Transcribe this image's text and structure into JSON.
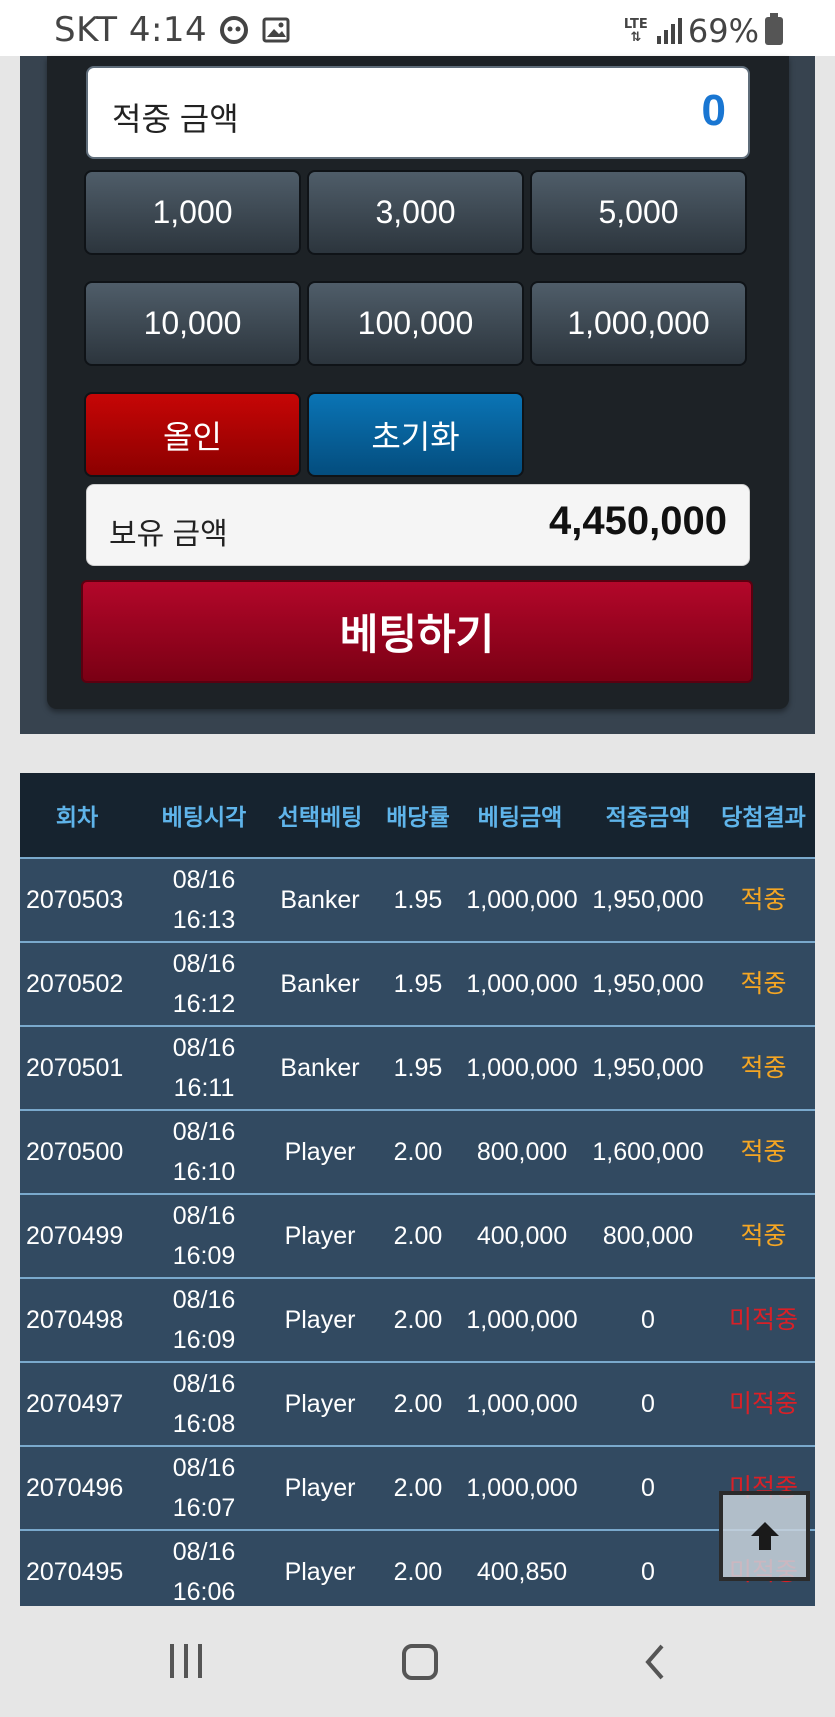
{
  "status_bar": {
    "carrier_time": "SKT 4:14",
    "lte": "LTE",
    "battery_pct": "69%",
    "icons": [
      "face-icon",
      "gallery-icon",
      "signal-icon",
      "battery-icon"
    ]
  },
  "panel": {
    "hit_amount_label": "적중 금액",
    "hit_amount_value": "0",
    "chips": [
      "1,000",
      "3,000",
      "5,000",
      "10,000",
      "100,000",
      "1,000,000"
    ],
    "allin_label": "올인",
    "reset_label": "초기화",
    "holding_label": "보유 금액",
    "holding_value": "4,450,000",
    "bet_button_label": "베팅하기"
  },
  "history": {
    "headers": [
      "회차",
      "베팅시각",
      "선택베팅",
      "배당률",
      "베팅금액",
      "적중금액",
      "당첨결과"
    ],
    "rows": [
      {
        "round": "2070503",
        "date": "08/16",
        "time": "16:13",
        "pick": "Banker",
        "odds": "1.95",
        "bet": "1,000,000",
        "win": "1,950,000",
        "result": "적중",
        "status": "hit"
      },
      {
        "round": "2070502",
        "date": "08/16",
        "time": "16:12",
        "pick": "Banker",
        "odds": "1.95",
        "bet": "1,000,000",
        "win": "1,950,000",
        "result": "적중",
        "status": "hit"
      },
      {
        "round": "2070501",
        "date": "08/16",
        "time": "16:11",
        "pick": "Banker",
        "odds": "1.95",
        "bet": "1,000,000",
        "win": "1,950,000",
        "result": "적중",
        "status": "hit"
      },
      {
        "round": "2070500",
        "date": "08/16",
        "time": "16:10",
        "pick": "Player",
        "odds": "2.00",
        "bet": "800,000",
        "win": "1,600,000",
        "result": "적중",
        "status": "hit"
      },
      {
        "round": "2070499",
        "date": "08/16",
        "time": "16:09",
        "pick": "Player",
        "odds": "2.00",
        "bet": "400,000",
        "win": "800,000",
        "result": "적중",
        "status": "hit"
      },
      {
        "round": "2070498",
        "date": "08/16",
        "time": "16:09",
        "pick": "Player",
        "odds": "2.00",
        "bet": "1,000,000",
        "win": "0",
        "result": "미적중",
        "status": "miss"
      },
      {
        "round": "2070497",
        "date": "08/16",
        "time": "16:08",
        "pick": "Player",
        "odds": "2.00",
        "bet": "1,000,000",
        "win": "0",
        "result": "미적중",
        "status": "miss"
      },
      {
        "round": "2070496",
        "date": "08/16",
        "time": "16:07",
        "pick": "Player",
        "odds": "2.00",
        "bet": "1,000,000",
        "win": "0",
        "result": "미적중",
        "status": "miss"
      },
      {
        "round": "2070495",
        "date": "08/16",
        "time": "16:06",
        "pick": "Player",
        "odds": "2.00",
        "bet": "400,850",
        "win": "0",
        "result": "미적중",
        "status": "miss"
      }
    ]
  },
  "colors": {
    "hit": "#f5a623",
    "miss": "#d92027",
    "header_text": "#5fb4ea",
    "accent_blue": "#1976d2"
  }
}
